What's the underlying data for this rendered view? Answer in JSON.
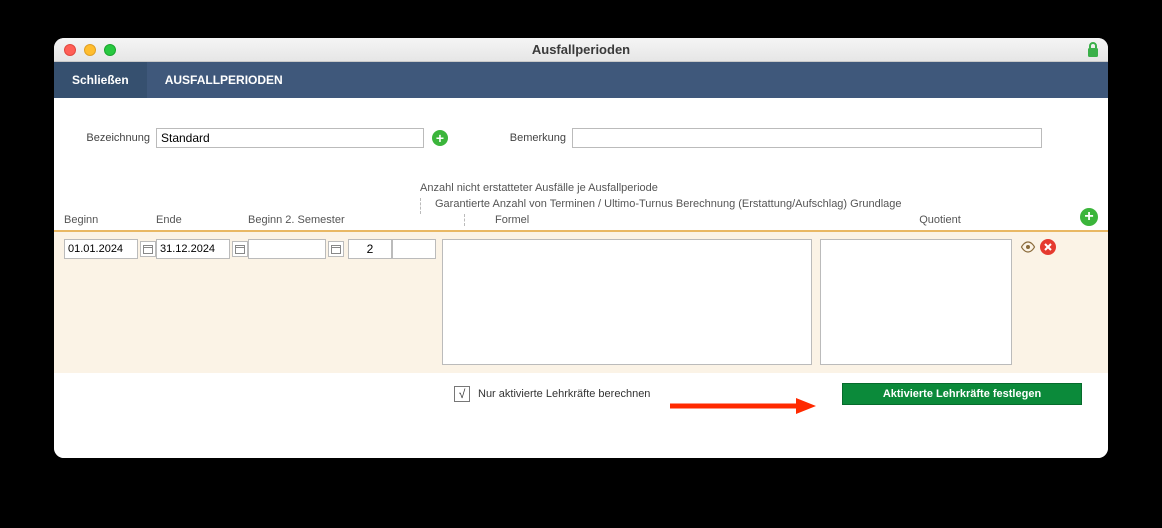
{
  "window": {
    "title": "Ausfallperioden"
  },
  "toolbar": {
    "close_label": "Schließen",
    "section_label": "AUSFALLPERIODEN"
  },
  "form": {
    "bezeichnung_label": "Bezeichnung",
    "bezeichnung_value": "Standard",
    "bemerkung_label": "Bemerkung",
    "bemerkung_value": ""
  },
  "headers": {
    "line1": "Anzahl nicht erstatteter Ausfälle je Ausfallperiode",
    "line2": "Garantierte Anzahl von Terminen / Ultimo-Turnus Berechnung (Erstattung/Aufschlag) Grundlage",
    "beginn": "Beginn",
    "ende": "Ende",
    "beginn2": "Beginn 2. Semester",
    "formel": "Formel",
    "quotient": "Quotient"
  },
  "rows": [
    {
      "beginn": "01.01.2024",
      "ende": "31.12.2024",
      "beginn2": "",
      "anzahl": "2",
      "extra": "",
      "formel": "",
      "quotient": ""
    }
  ],
  "footer": {
    "checkbox_checked": "√",
    "checkbox_label": "Nur aktivierte Lehrkräfte berechnen",
    "button_label": "Aktivierte Lehrkräfte festlegen"
  }
}
